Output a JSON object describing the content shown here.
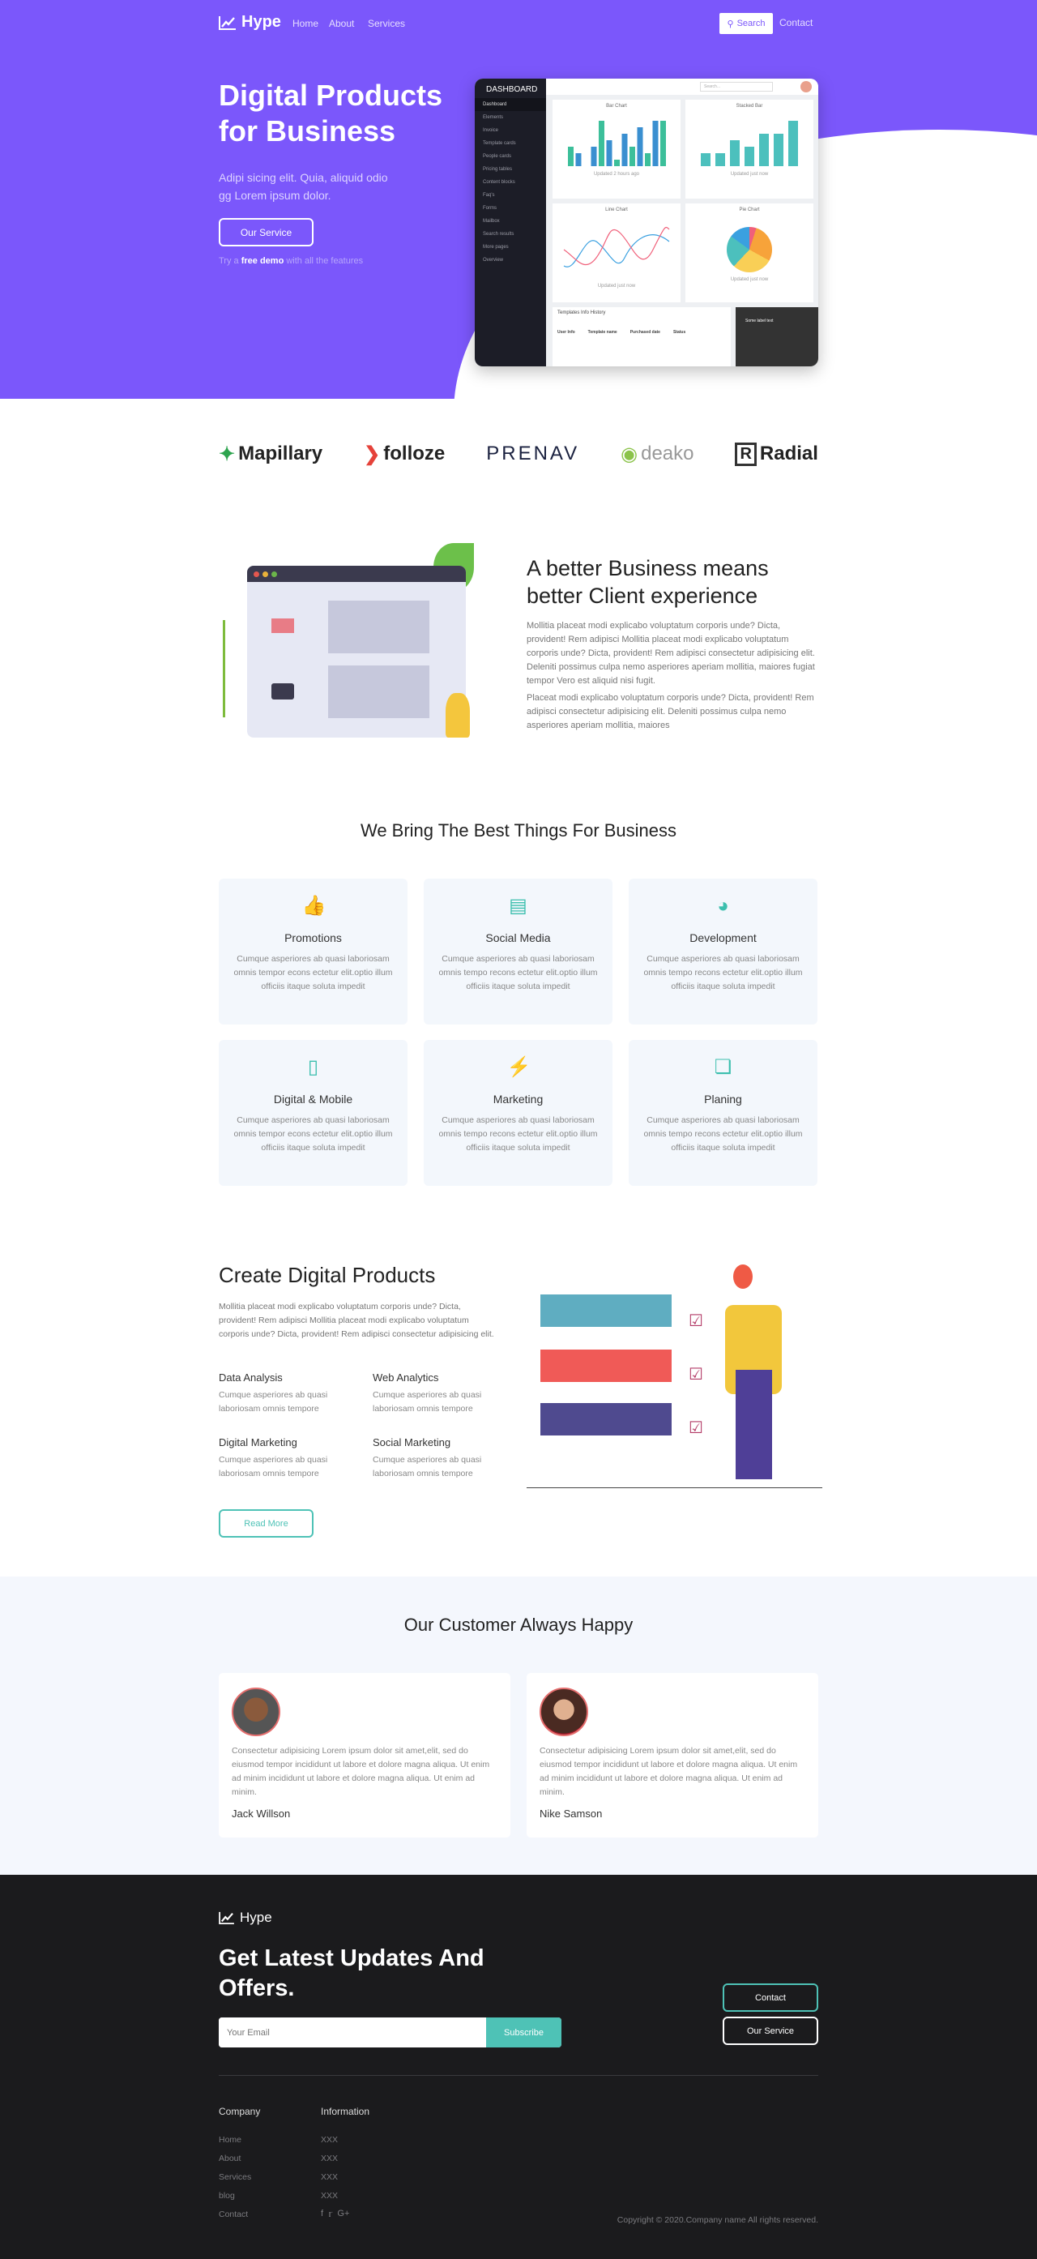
{
  "nav": {
    "brand": "Hype",
    "links": [
      "Home",
      "About",
      "Services"
    ],
    "search": "Search",
    "contact": "Contact"
  },
  "hero": {
    "title": "Digital Products for Business",
    "subtitle": "Adipi sicing elit. Quia, aliquid odio gg Lorem ipsum dolor.",
    "button": "Our Service",
    "note_pre": "Try a",
    "note_bold": "free demo",
    "note_post": "with all the features",
    "accent": "#7b57fb"
  },
  "dashboard": {
    "title": "DASHBOARD",
    "menu": [
      "Dashboard",
      "Elements",
      "Invoice",
      "Template cards",
      "People cards",
      "Pricing tables",
      "Content blocks",
      "Faq's",
      "Forms",
      "Mailbox",
      "Search results",
      "More pages",
      "Overview"
    ],
    "search_placeholder": "Search...",
    "cards": [
      {
        "title": "Bar Chart",
        "footer": "Updated 2 hours ago"
      },
      {
        "title": "Stacked Bar",
        "footer": "Updated just now"
      },
      {
        "title": "Line Chart",
        "footer": "Updated just now"
      },
      {
        "title": "Pie Chart",
        "footer": "Updated just now"
      }
    ],
    "table": {
      "title": "Templates Info History",
      "search": "Search...",
      "columns": [
        "User Info",
        "Template name",
        "Purchased date",
        "Status"
      ]
    },
    "image_label": "Some label text"
  },
  "partners": [
    "Mapillary",
    "folloze",
    "PRENAV",
    "deako",
    "Radial"
  ],
  "about": {
    "title": "A better Business means better Client experience",
    "p1": "Mollitia placeat modi explicabo voluptatum corporis unde? Dicta, provident! Rem adipisci Mollitia placeat modi explicabo voluptatum corporis unde? Dicta, provident! Rem adipisci consectetur adipisicing elit. Deleniti possimus culpa nemo asperiores aperiam mollitia, maiores fugiat tempor Vero est aliquid nisi fugit.",
    "p2": "Placeat modi explicabo voluptatum corporis unde? Dicta, provident! Rem adipisci consectetur adipisicing elit. Deleniti possimus culpa nemo asperiores aperiam mollitia, maiores"
  },
  "services": {
    "title": "We Bring The Best Things For Business",
    "icon_color": "#3cbfae",
    "items": [
      {
        "icon": "thumbs-up-icon",
        "title": "Promotions",
        "text": "Cumque asperiores ab quasi laboriosam omnis tempor econs ectetur elit.optio illum officiis itaque soluta impedit"
      },
      {
        "icon": "image-icon",
        "title": "Social Media",
        "text": "Cumque asperiores ab quasi laboriosam omnis tempo recons ectetur elit.optio illum officiis itaque soluta impedit"
      },
      {
        "icon": "pie-chart-icon",
        "title": "Development",
        "text": "Cumque asperiores ab quasi laboriosam omnis tempo recons ectetur elit.optio illum officiis itaque soluta impedit"
      },
      {
        "icon": "mobile-icon",
        "title": "Digital & Mobile",
        "text": "Cumque asperiores ab quasi laboriosam omnis tempor econs ectetur elit.optio illum officiis itaque soluta impedit"
      },
      {
        "icon": "bolt-icon",
        "title": "Marketing",
        "text": "Cumque asperiores ab quasi laboriosam omnis tempo recons ectetur elit.optio illum officiis itaque soluta impedit"
      },
      {
        "icon": "cubes-icon",
        "title": "Planing",
        "text": "Cumque asperiores ab quasi laboriosam omnis tempo recons ectetur elit.optio illum officiis itaque soluta impedit"
      }
    ]
  },
  "create": {
    "title": "Create Digital Products",
    "text": "Mollitia placeat modi explicabo voluptatum corporis unde? Dicta, provident! Rem adipisci Mollitia placeat modi explicabo voluptatum corporis unde? Dicta, provident! Rem adipisci consectetur adipisicing elit.",
    "features": [
      {
        "title": "Data Analysis",
        "text": "Cumque asperiores ab quasi laboriosam omnis tempore"
      },
      {
        "title": "Web Analytics",
        "text": "Cumque asperiores ab quasi laboriosam omnis tempore"
      },
      {
        "title": "Digital Marketing",
        "text": "Cumque asperiores ab quasi laboriosam omnis tempore"
      },
      {
        "title": "Social Marketing",
        "text": "Cumque asperiores ab quasi laboriosam omnis tempore"
      }
    ],
    "button": "Read More"
  },
  "testimonials": {
    "title": "Our Customer Always Happy",
    "items": [
      {
        "text": "Consectetur adipisicing Lorem ipsum dolor sit amet,elit, sed do eiusmod tempor incididunt ut labore et dolore magna aliqua. Ut enim ad minim incididunt ut labore et dolore magna aliqua. Ut enim ad minim.",
        "name": "Jack Willson"
      },
      {
        "text": "Consectetur adipisicing Lorem ipsum dolor sit amet,elit, sed do eiusmod tempor incididunt ut labore et dolore magna aliqua. Ut enim ad minim incididunt ut labore et dolore magna aliqua. Ut enim ad minim.",
        "name": "Nike Samson"
      }
    ]
  },
  "footer": {
    "brand": "Hype",
    "title": "Get Latest Updates And Offers.",
    "email_placeholder": "Your Email",
    "subscribe": "Subscribe",
    "contact": "Contact",
    "service": "Our Service",
    "company_title": "Company",
    "company_links": [
      "Home",
      "About",
      "Services",
      "blog",
      "Contact"
    ],
    "info_title": "Information",
    "info_links": [
      "XXX",
      "XXX",
      "XXX",
      "XXX"
    ],
    "social": [
      "facebook-icon",
      "twitter-icon",
      "google-plus-icon"
    ],
    "copyright": "Copyright © 2020.Company name All rights reserved.",
    "teal": "#4ec2b6"
  }
}
